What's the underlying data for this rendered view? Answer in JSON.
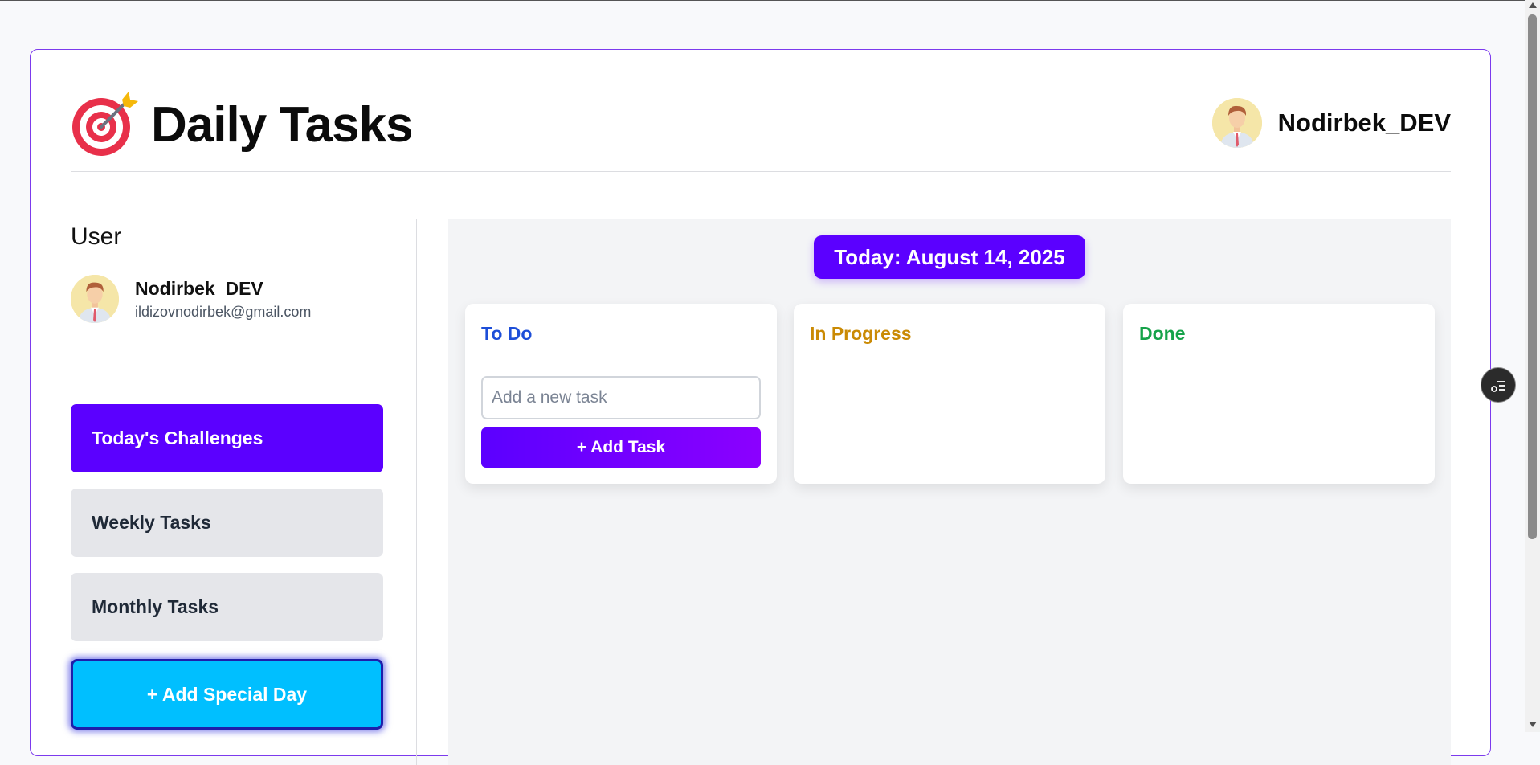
{
  "header": {
    "title": "Daily Tasks",
    "username": "Nodirbek_DEV",
    "logo_icon": "target-arrow-icon"
  },
  "sidebar": {
    "heading": "User",
    "profile": {
      "name": "Nodirbek_DEV",
      "email": "ildizovnodirbek@gmail.com",
      "avatar_icon": "man-avatar-icon"
    },
    "nav": [
      {
        "label": "Today's Challenges",
        "active": true
      },
      {
        "label": "Weekly Tasks",
        "active": false
      },
      {
        "label": "Monthly Tasks",
        "active": false
      }
    ],
    "special_button": "+ Add Special Day"
  },
  "main": {
    "date_badge": "Today: August 14, 2025",
    "columns": [
      {
        "title": "To Do",
        "color": "#1d4ed8"
      },
      {
        "title": "In Progress",
        "color": "#ca8a04"
      },
      {
        "title": "Done",
        "color": "#16a34a"
      }
    ],
    "task_input_placeholder": "Add a new task",
    "add_task_button": "+ Add Task"
  },
  "colors": {
    "accent": "#5b00ff",
    "special": "#00bfff",
    "border": "#7c3aed"
  }
}
